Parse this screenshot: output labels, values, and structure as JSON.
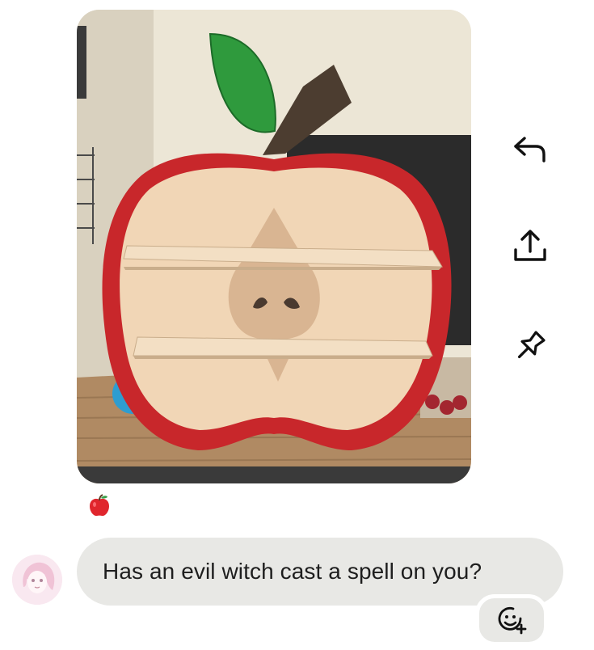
{
  "message": {
    "text": "Has an evil witch cast a spell on you?"
  },
  "reaction": {
    "emoji": "red-apple-emoji"
  },
  "icons": {
    "reply": "reply-arrow-icon",
    "share": "share-upload-icon",
    "pin": "pin-icon",
    "add_reaction": "add-reaction-smiley-icon"
  },
  "colors": {
    "bubble": "#e8e8e5",
    "text": "#1e1e1e"
  }
}
